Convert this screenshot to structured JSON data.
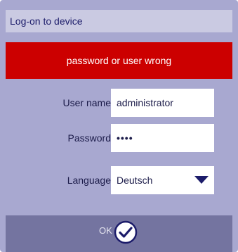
{
  "window": {
    "title": "Log-on to device"
  },
  "error": {
    "message": "password or user wrong"
  },
  "form": {
    "username": {
      "label": "User name",
      "value": "administrator"
    },
    "password": {
      "label": "Password",
      "masked_value": "••••"
    },
    "language": {
      "label": "Language",
      "selected": "Deutsch"
    }
  },
  "footer": {
    "ok_label": "OK",
    "ok_icon": "checkmark-circle-icon"
  },
  "colors": {
    "dialog_bg": "#a8a8d0",
    "title_bg": "#cacae2",
    "error_bg": "#cc0000",
    "footer_bg": "#7474a0",
    "text_dark": "#1c1c6a"
  }
}
